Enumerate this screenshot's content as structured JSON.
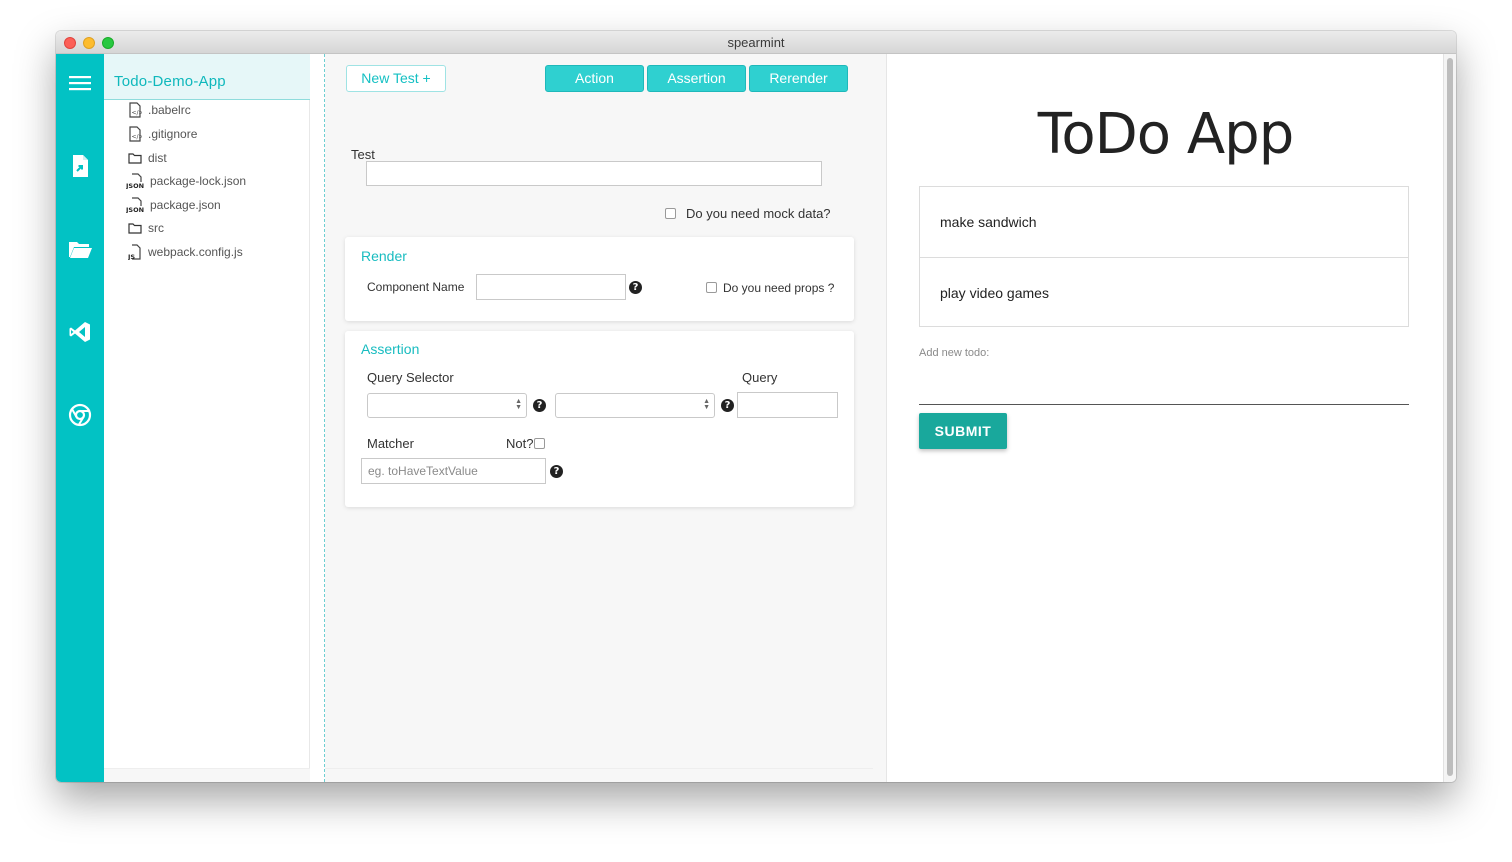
{
  "window": {
    "title": "spearmint"
  },
  "iconbar": {
    "icons": [
      "menu-icon",
      "export-file-icon",
      "open-folder-icon",
      "vscode-icon",
      "chrome-icon"
    ]
  },
  "filetree": {
    "project_name": "Todo-Demo-App",
    "items": [
      {
        "name": ".babelrc",
        "icon": "config-file-icon"
      },
      {
        "name": ".gitignore",
        "icon": "config-file-icon"
      },
      {
        "name": "dist",
        "icon": "folder-icon"
      },
      {
        "name": "package-lock.json",
        "icon": "json-file-icon"
      },
      {
        "name": "package.json",
        "icon": "json-file-icon"
      },
      {
        "name": "src",
        "icon": "folder-icon"
      },
      {
        "name": "webpack.config.js",
        "icon": "js-file-icon"
      }
    ]
  },
  "toolbar": {
    "new_test_label": "New Test +",
    "action_label": "Action",
    "assertion_label": "Assertion",
    "rerender_label": "Rerender"
  },
  "test_form": {
    "test_label": "Test",
    "test_value": "",
    "mock_data_label": "Do you need mock data?"
  },
  "render_card": {
    "title": "Render",
    "component_name_label": "Component Name",
    "component_name_value": "",
    "props_label": "Do you need props ?"
  },
  "assertion_card": {
    "title": "Assertion",
    "query_selector_label": "Query Selector",
    "query_label": "Query",
    "matcher_label": "Matcher",
    "not_label": "Not?",
    "matcher_placeholder": "eg. toHaveTextValue"
  },
  "preview": {
    "title": "ToDo App",
    "todos": [
      "make sandwich",
      "play video games"
    ],
    "add_label": "Add new todo:",
    "submit_label": "SUBMIT"
  },
  "colors": {
    "accent": "#02c2c4",
    "button": "#2fd0d0",
    "submit": "#19a89c"
  }
}
